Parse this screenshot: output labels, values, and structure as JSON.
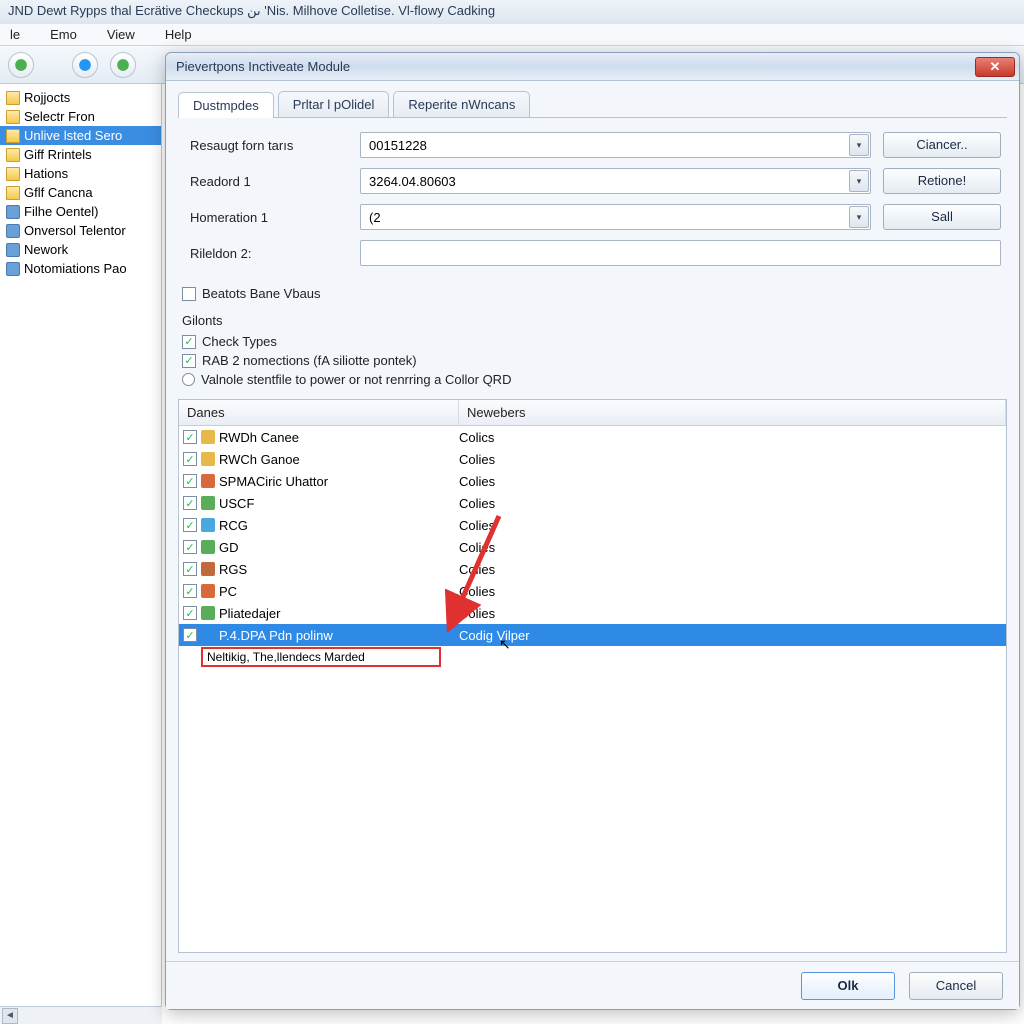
{
  "main_window": {
    "title": "JND Dewt Rypps thal Ecrätive Checkups ىن 'Nis. Milhove Colletise. Vl-flowy Cadking"
  },
  "menu": [
    "le",
    "Emo",
    "View",
    "Help"
  ],
  "tree": {
    "items": [
      {
        "label": "Rojjocts",
        "icon": "folder"
      },
      {
        "label": "Selectr Fron",
        "icon": "folder"
      },
      {
        "label": "Unlive lsted Sero",
        "icon": "folder",
        "selected": true
      },
      {
        "label": "Giff Rrintels",
        "icon": "folder"
      },
      {
        "label": "Hations",
        "icon": "folder"
      },
      {
        "label": "Gflf Cancna",
        "icon": "folder"
      },
      {
        "label": "Filhe Oentel)",
        "icon": "obj"
      },
      {
        "label": "Onversol Telentor",
        "icon": "obj"
      },
      {
        "label": "Nework",
        "icon": "obj"
      },
      {
        "label": "Notomiations Pao",
        "icon": "obj"
      }
    ]
  },
  "dialog": {
    "title": "Pievertpons Inctiveate Module",
    "tabs": [
      "Dustmpdes",
      "Prltar l pOlidel",
      "Reperite nWncans"
    ],
    "active_tab": 0,
    "form": {
      "rows": [
        {
          "label": "Resaugt forn tarıs",
          "value": "00151228",
          "type": "combo"
        },
        {
          "label": "Readord 1",
          "value": "3264.04.80603",
          "type": "combo"
        },
        {
          "label": "Homeration 1",
          "value": "(2",
          "type": "combo"
        },
        {
          "label": "Rileldon 2:",
          "value": "",
          "type": "text"
        }
      ],
      "side_buttons": [
        "Ciancer..",
        "Retione!",
        "Sall"
      ]
    },
    "checkbox_single": {
      "label": "Beatots Bane Vbaus",
      "checked": false
    },
    "section": "Gilonts",
    "options": [
      {
        "type": "check",
        "checked": true,
        "label": "Check Types"
      },
      {
        "type": "check",
        "checked": true,
        "label": "RAB 2 nomections (fA siliotte pontek)"
      },
      {
        "type": "radio",
        "checked": false,
        "label": "Valnole stentfile to power or not renrring a Collor QRD"
      }
    ],
    "grid": {
      "headers": [
        "Danes",
        "Newebers"
      ],
      "rows": [
        {
          "checked": true,
          "color": "#e6b84a",
          "name": "RWDh Canee",
          "member": "Colics"
        },
        {
          "checked": true,
          "color": "#e6b84a",
          "name": "RWCh Ganoe",
          "member": "Colies"
        },
        {
          "checked": true,
          "color": "#d86a3a",
          "name": "SPMACiric Uhattor",
          "member": "Colies"
        },
        {
          "checked": true,
          "color": "#5aae5a",
          "name": "USCF",
          "member": "Colies"
        },
        {
          "checked": true,
          "color": "#4aa8e0",
          "name": "RCG",
          "member": "Colies"
        },
        {
          "checked": true,
          "color": "#5aae5a",
          "name": "GD",
          "member": "Colies"
        },
        {
          "checked": true,
          "color": "#c06a3a",
          "name": "RGS",
          "member": "Colies"
        },
        {
          "checked": true,
          "color": "#d86a3a",
          "name": "PC",
          "member": "Colies"
        },
        {
          "checked": true,
          "color": "#5aae5a",
          "name": "Pliatedajer",
          "member": "Colies"
        },
        {
          "checked": true,
          "color": "#2f8ae6",
          "name": "P.4.DPA Pdn polinw",
          "member": "Codig Vilper",
          "selected": true
        }
      ],
      "highlight_row": "Neltikig, The,llendecs Marded"
    },
    "footer": {
      "ok": "Olk",
      "cancel": "Cancel"
    }
  },
  "colors": {
    "accent": "#2f8ae6",
    "annotation": "#e03030"
  }
}
